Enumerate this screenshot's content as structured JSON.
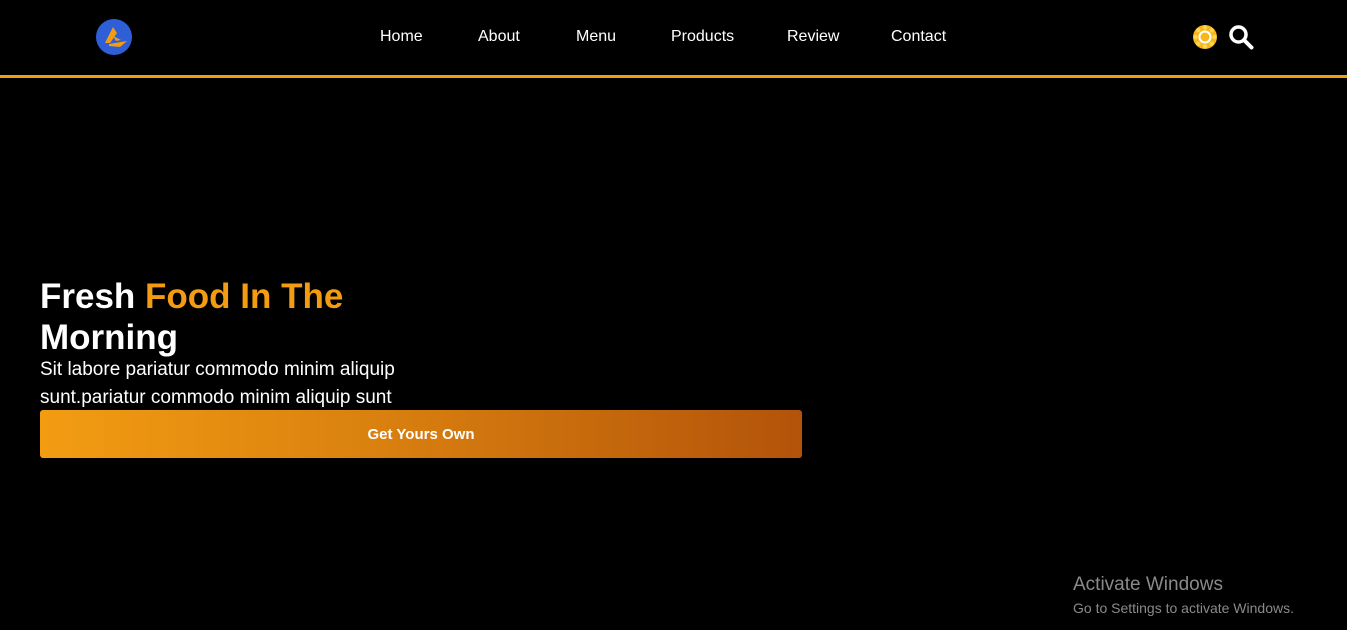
{
  "header": {
    "nav": [
      {
        "label": "Home"
      },
      {
        "label": "About"
      },
      {
        "label": "Menu"
      },
      {
        "label": "Products"
      },
      {
        "label": "Review"
      },
      {
        "label": "Contact"
      }
    ],
    "icons": {
      "logo": "logo-icon",
      "theme": "sun-icon",
      "search": "search-icon"
    }
  },
  "hero": {
    "title_part1": "Fresh",
    "title_accent": "Food In The",
    "title_part2": "Morning",
    "description": "Sit labore pariatur commodo minim aliquip sunt.pariatur commodo minim aliquip sunt",
    "cta_label": "Get Yours Own"
  },
  "watermark": {
    "title": "Activate Windows",
    "subtitle": "Go to Settings to activate Windows."
  },
  "colors": {
    "background": "#000000",
    "accent": "#f39c12",
    "accent_dark": "#b3530a",
    "logo_blue": "#2f5fd6",
    "text": "#ffffff",
    "watermark": "#8a8a8a"
  }
}
